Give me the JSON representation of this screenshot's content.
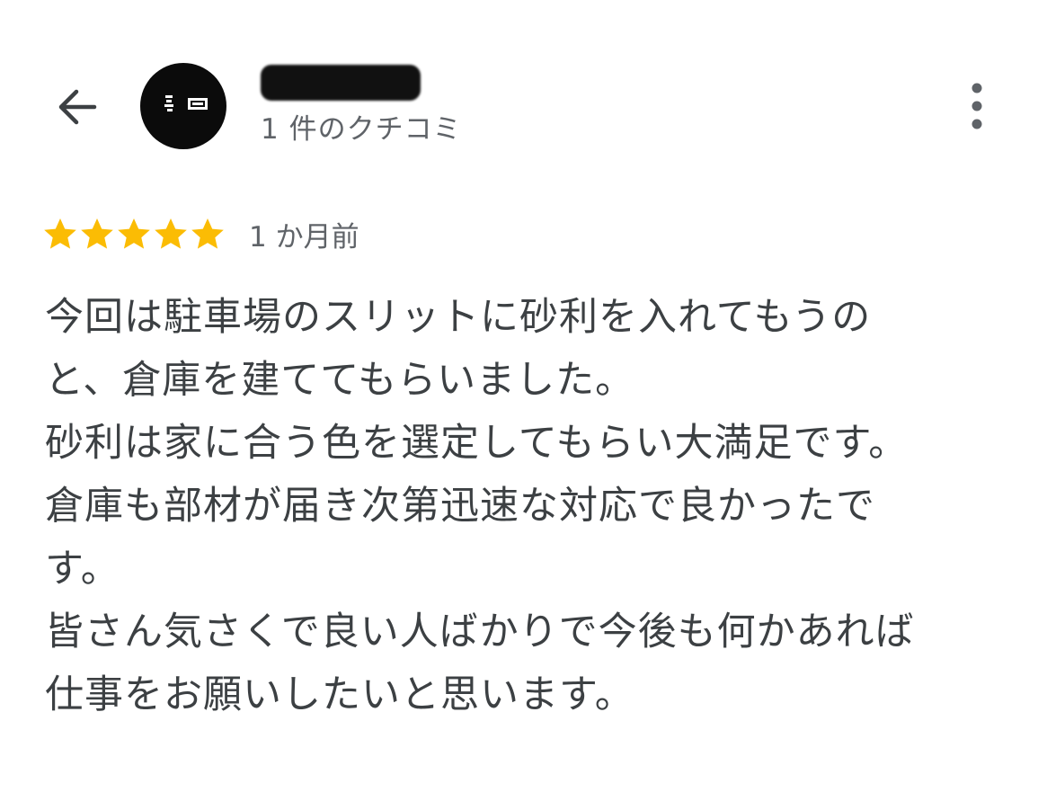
{
  "header": {
    "back_icon": "arrow-back-icon",
    "avatar_icon": "profile-avatar-icon",
    "reviewer_name": "",
    "review_count": "1 件のクチコミ",
    "more_icon": "more-vert-icon"
  },
  "review": {
    "rating": 5,
    "max_rating": 5,
    "star_color": "#fbbc04",
    "date": "1 か月前",
    "text_lines": [
      "今回は駐車場のスリットに砂利を入れてもうの",
      "と、倉庫を建ててもらいました。",
      "砂利は家に合う色を選定してもらい大満足です。",
      "倉庫も部材が届き次第迅速な対応で良かったで",
      "す。",
      "皆さん気さくで良い人ばかりで今後も何かあれば",
      "仕事をお願いしたいと思います。"
    ]
  }
}
